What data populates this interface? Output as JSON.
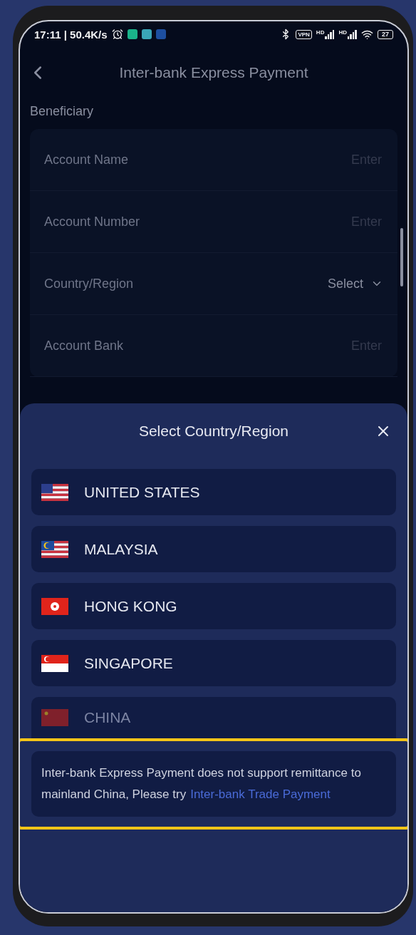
{
  "status_bar": {
    "text": "17:11 | 50.4K/s",
    "vpn": "VPN",
    "signals": [
      "HD",
      "HD"
    ],
    "battery": "27"
  },
  "header": {
    "title": "Inter-bank Express Payment"
  },
  "section": {
    "title": "Beneficiary"
  },
  "fields": [
    {
      "label": "Account Name",
      "kind": "input",
      "placeholder": "Enter"
    },
    {
      "label": "Account Number",
      "kind": "input",
      "placeholder": "Enter"
    },
    {
      "label": "Country/Region",
      "kind": "select",
      "value": "Select"
    },
    {
      "label": "Account Bank",
      "kind": "input",
      "placeholder": "Enter"
    }
  ],
  "sheet": {
    "title": "Select Country/Region",
    "countries": [
      {
        "name": "UNITED STATES",
        "kind": "stars",
        "disabled": false
      },
      {
        "name": "MALAYSIA",
        "kind": "crescent",
        "disabled": false
      },
      {
        "name": "HONG KONG",
        "kind": "flower",
        "disabled": false
      },
      {
        "name": "SINGAPORE",
        "kind": "bicolor",
        "disabled": false
      },
      {
        "name": "CHINA",
        "kind": "star",
        "disabled": true
      }
    ],
    "notice": {
      "text": "Inter-bank Express Payment does not support remittance to mainland China, Please try",
      "link": "Inter-bank Trade Payment",
      "highlighted": true
    }
  }
}
